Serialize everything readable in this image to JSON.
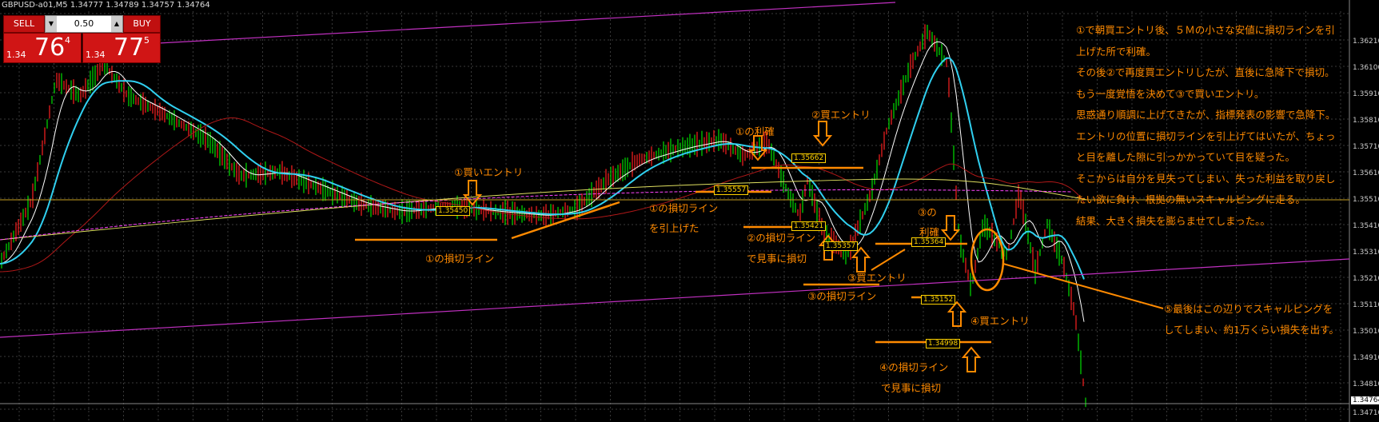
{
  "header": {
    "title": "GBPUSD-a01,M5  1.34777 1.34789 1.34757 1.34764"
  },
  "trade_panel": {
    "sell_label": "SELL",
    "buy_label": "BUY",
    "lot_value": "0.50",
    "sell_small": "1.34",
    "sell_big": "76",
    "sell_tiny": "4",
    "buy_small": "1.34",
    "buy_big": "77",
    "buy_tiny": "5"
  },
  "notes": [
    "①で朝買エントリ後、５Ｍの小さな安値に損切ラインを引上げた所で利確。",
    "その後②で再度買エントリしたが、直後に急降下で損切。",
    "もう一度覚悟を決めて③で買いエントリ。",
    "思惑通り順調に上げてきたが、指標発表の影響で急降下。",
    "エントリの位置に損切ラインを引上げてはいたが、ちょっと目を離した隙に引っかかっていて目を疑った。",
    "そこからは自分を見失ってしまい、失った利益を取り戻したい欲に負け、根拠の無いスキャルピングに走る。",
    "結果、大きく損失を膨らませてしまった。。"
  ],
  "annotations": {
    "a1": "①買いエントリ",
    "a2": "①の損切ライン",
    "a3": "①の損切ライン",
    "a4": "を引上げた",
    "a5": "①の利確",
    "a6": "②買エントリ",
    "a7": "②の損切ライン",
    "a8": "で見事に損切",
    "a9": "③の",
    "a10": "利確",
    "a11": "③買エントリ",
    "a12": "③の損切ライン",
    "a13": "④買エントリ",
    "a14": "④の損切ライン",
    "a15": "で見事に損切",
    "a16": "⑤最後はこの辺りでスキャルピングを",
    "a17": "してしまい、約1万くらい損失を出す。"
  },
  "price_boxes": {
    "b1": "1.35557",
    "b2": "1.35662",
    "b3": "1.35421",
    "b4": "1.35357",
    "b5": "1.35364",
    "b6": "1.35152",
    "b7": "1.34998",
    "b8": "1.35450"
  },
  "price_scale": [
    "1.36210",
    "1.36100",
    "1.35910",
    "1.35810",
    "1.35710",
    "1.35610",
    "1.35510",
    "1.35410",
    "1.35310",
    "1.35210",
    "1.35110",
    "1.35010",
    "1.34910",
    "1.34810",
    "1.34710"
  ],
  "current_price": "1.34764",
  "colors": {
    "buy": "#d01515",
    "sell": "#d01515",
    "annotation": "#ff8a00",
    "grid": "#3a3a3a"
  }
}
